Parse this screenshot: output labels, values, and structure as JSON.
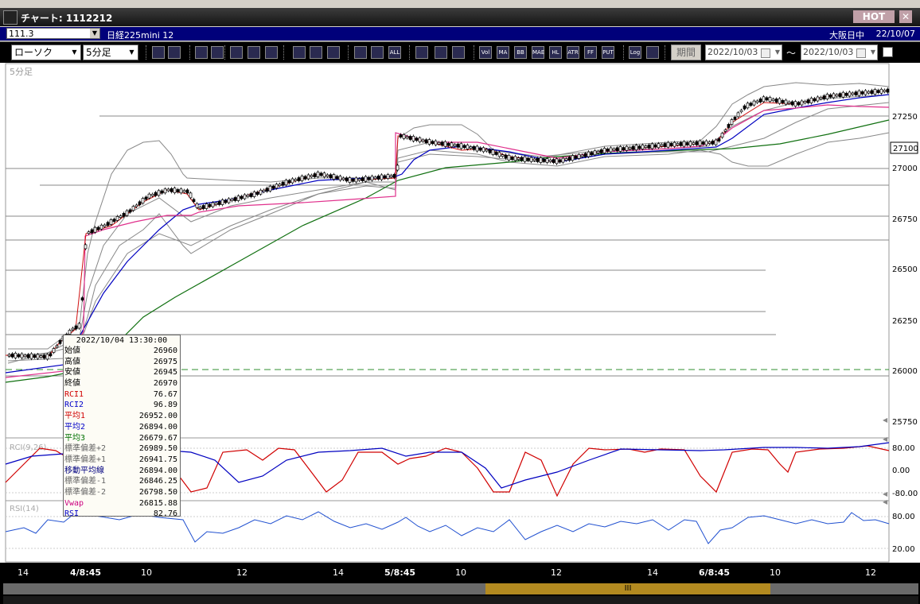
{
  "window": {
    "title": "チャート: 1112212",
    "hot_label": "HOT",
    "close_label": "✕"
  },
  "info": {
    "code": "111.3",
    "instrument": "日経225mini 12",
    "session": "大阪日中",
    "date": "22/10/07"
  },
  "toolbar": {
    "chart_type": "ローソク",
    "interval": "5分足",
    "buttons": [
      "zoom",
      "bar-width",
      "down-arrow",
      "search-date",
      "draw-line",
      "candle-mode",
      "blank",
      "draw-trend",
      "cursor",
      "reset",
      "candle-a",
      "candle-b",
      "all",
      "pattern",
      "color-pen",
      "palette",
      "vol",
      "ma",
      "bb",
      "mae",
      "hl",
      "atr",
      "ff",
      "put",
      "log",
      "export"
    ],
    "button_labels": {
      "all": "ALL",
      "vol": "Vol",
      "ma": "MA",
      "bb": "BB",
      "mae": "MAE",
      "hl": "HL",
      "atr": "ATR",
      "ff": "FF",
      "put": "PUT",
      "log": "Log"
    },
    "period_label": "期間",
    "date_from": "2022/10/03",
    "date_to": "2022/10/03",
    "tilde": "〜"
  },
  "chart": {
    "panel_label": "5分足",
    "price_ticks": [
      "27250",
      "27000",
      "26750",
      "26500",
      "26250",
      "26000",
      "25750"
    ],
    "current_price": "27100",
    "rci_label": "RCI(9,26)",
    "rci_ticks": [
      "80.00",
      "0.00",
      "-80.00"
    ],
    "rsi_label": "RSI(14)",
    "rsi_ticks": [
      "80.00",
      "20.00"
    ],
    "x_labels": [
      "14",
      "4/8:45",
      "10",
      "12",
      "14",
      "5/8:45",
      "10",
      "12",
      "14",
      "6/8:45",
      "10",
      "12"
    ],
    "scroll_thumb_label": "III"
  },
  "popup": {
    "datetime": "2022/10/04 13:30:00",
    "rows": [
      {
        "k": "始値",
        "v": "26960",
        "c": "black"
      },
      {
        "k": "高値",
        "v": "26975",
        "c": "black"
      },
      {
        "k": "安値",
        "v": "26945",
        "c": "black"
      },
      {
        "k": "終値",
        "v": "26970",
        "c": "black"
      },
      {
        "k": "RCI1",
        "v": "76.67",
        "c": "red"
      },
      {
        "k": "RCI2",
        "v": "96.89",
        "c": "blue"
      },
      {
        "k": "平均1",
        "v": "26952.00",
        "c": "red"
      },
      {
        "k": "平均2",
        "v": "26894.00",
        "c": "blue"
      },
      {
        "k": "平均3",
        "v": "26679.67",
        "c": "green"
      },
      {
        "k": "標準偏差+2",
        "v": "26989.50",
        "c": "gray"
      },
      {
        "k": "標準偏差+1",
        "v": "26941.75",
        "c": "gray"
      },
      {
        "k": "移動平均線",
        "v": "26894.00",
        "c": "navy"
      },
      {
        "k": "標準偏差-1",
        "v": "26846.25",
        "c": "gray"
      },
      {
        "k": "標準偏差-2",
        "v": "26798.50",
        "c": "gray"
      },
      {
        "k": "Vwap",
        "v": "26815.88",
        "c": "pink"
      },
      {
        "k": "RSI",
        "v": "82.76",
        "c": "blue"
      }
    ]
  }
}
